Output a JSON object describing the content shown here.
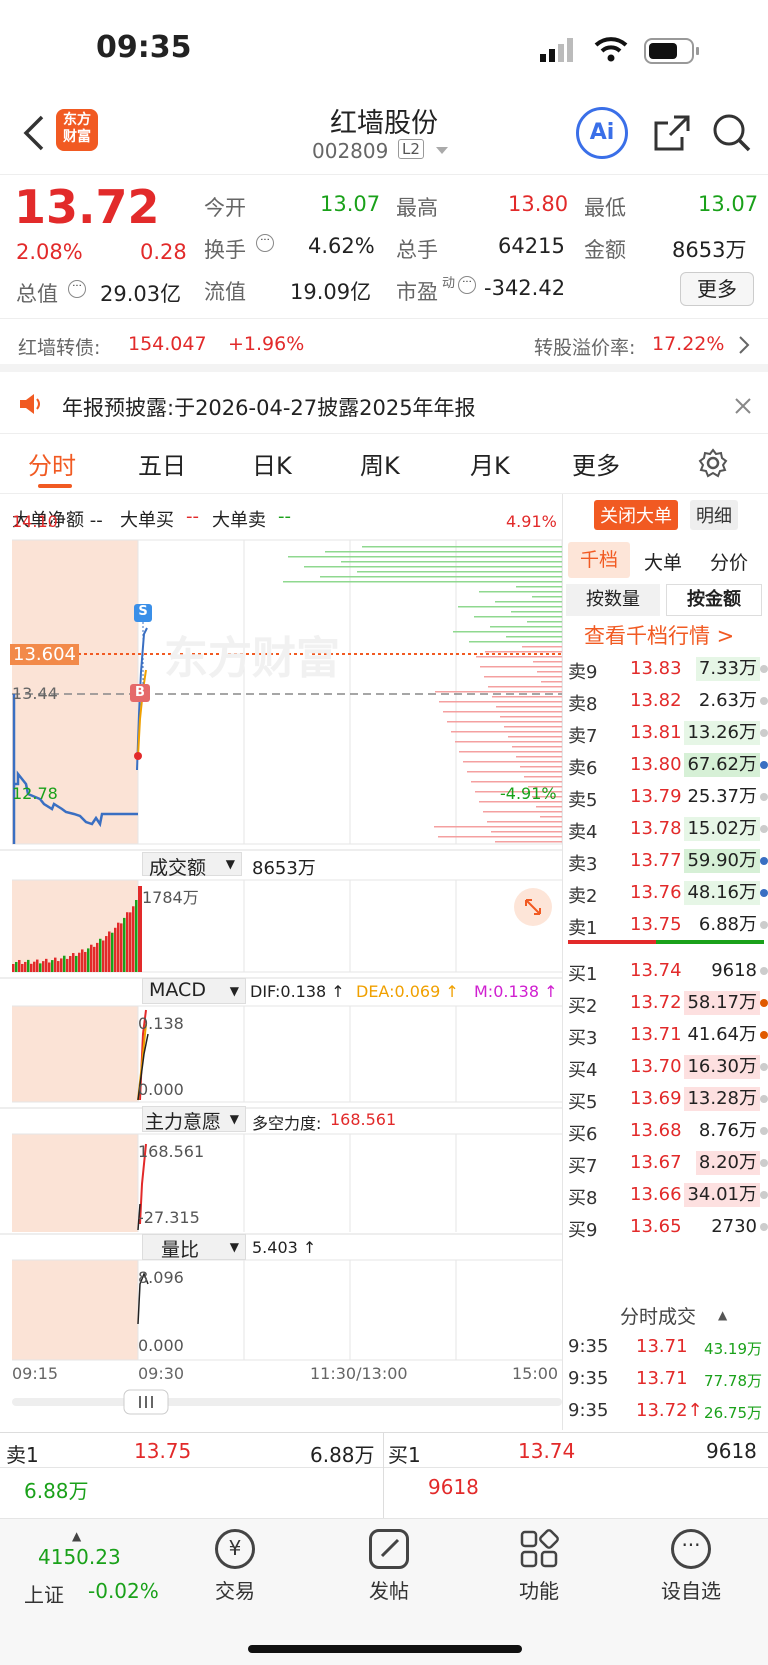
{
  "status": {
    "time": "09:35"
  },
  "header": {
    "title": "红墙股份",
    "code": "002809",
    "level": "L2",
    "logo": "东方\n财富",
    "ai": "Ai"
  },
  "quote": {
    "price": "13.72",
    "pct": "2.08%",
    "chg": "0.28",
    "open_l": "今开",
    "open": "13.07",
    "high_l": "最高",
    "high": "13.80",
    "low_l": "最低",
    "low": "13.07",
    "turn_l": "换手",
    "turn": "4.62%",
    "vol_l": "总手",
    "vol": "64215",
    "amt_l": "金额",
    "amt": "8653万",
    "cap_l": "总值",
    "cap": "29.03亿",
    "float_l": "流值",
    "float": "19.09亿",
    "pe_l": "市盈",
    "pe_sup": "动",
    "pe": "-342.42",
    "more": "更多"
  },
  "bond": {
    "label": "红墙转债:",
    "price": "154.047",
    "pct": "+1.96%",
    "prem_l": "转股溢价率:",
    "prem": "17.22%"
  },
  "notice": {
    "text": "年报预披露:于2026-04-27披露2025年年报"
  },
  "tabs": [
    "分时",
    "五日",
    "日K",
    "周K",
    "月K",
    "更多"
  ],
  "legend": {
    "net": "大单净额 --",
    "buy": "大单买",
    "buy_d": "--",
    "sell": "大单卖",
    "sell_d": "--",
    "close": "关闭大单",
    "detail": "明细"
  },
  "chart": {
    "ymax": "14.10",
    "ymin": "12.78",
    "pmax": "4.91%",
    "pmin": "-4.91%",
    "ref": "13.44",
    "cur": "13.604",
    "watermark": "东方财富",
    "vol_title": "成交额",
    "vol_total": "8653万",
    "vol_max": "1784万",
    "macd_title": "MACD",
    "dif": "DIF:0.138 ↑",
    "dea": "DEA:0.069 ↑",
    "m": "M:0.138 ↑",
    "macd_hi": "0.138",
    "macd_lo": "0.000",
    "main_title": "主力意愿",
    "dk_l": "多空力度:",
    "dk": "168.561",
    "main_hi": "168.561",
    "main_lo": "-27.315",
    "lb_title": "量比",
    "lb_val": "5.403 ↑",
    "lb_hi": "8.096",
    "lb_lo": "0.000",
    "t0": "09:15",
    "t1": "09:30",
    "t2": "11:30/13:00",
    "t3": "15:00",
    "marker_s": "S",
    "marker_b": "B"
  },
  "orderbook": {
    "tab1": "千档",
    "tab2": "大单",
    "tab3": "分价",
    "mode1": "按数量",
    "mode2": "按金额",
    "link": "查看千档行情 >",
    "asks": [
      {
        "l": "卖9",
        "p": "13.83",
        "v": "7.33万"
      },
      {
        "l": "卖8",
        "p": "13.82",
        "v": "2.63万"
      },
      {
        "l": "卖7",
        "p": "13.81",
        "v": "13.26万"
      },
      {
        "l": "卖6",
        "p": "13.80",
        "v": "67.62万"
      },
      {
        "l": "卖5",
        "p": "13.79",
        "v": "25.37万"
      },
      {
        "l": "卖4",
        "p": "13.78",
        "v": "15.02万"
      },
      {
        "l": "卖3",
        "p": "13.77",
        "v": "59.90万"
      },
      {
        "l": "卖2",
        "p": "13.76",
        "v": "48.16万"
      },
      {
        "l": "卖1",
        "p": "13.75",
        "v": "6.88万"
      }
    ],
    "bids": [
      {
        "l": "买1",
        "p": "13.74",
        "v": "9618"
      },
      {
        "l": "买2",
        "p": "13.72",
        "v": "58.17万"
      },
      {
        "l": "买3",
        "p": "13.71",
        "v": "41.64万"
      },
      {
        "l": "买4",
        "p": "13.70",
        "v": "16.30万"
      },
      {
        "l": "买5",
        "p": "13.69",
        "v": "13.28万"
      },
      {
        "l": "买6",
        "p": "13.68",
        "v": "8.76万"
      },
      {
        "l": "买7",
        "p": "13.67",
        "v": "8.20万"
      },
      {
        "l": "买8",
        "p": "13.66",
        "v": "34.01万"
      },
      {
        "l": "买9",
        "p": "13.65",
        "v": "2730"
      }
    ],
    "trade_title": "分时成交",
    "trades": [
      {
        "t": "9:35",
        "p": "13.71",
        "v": "43.19万"
      },
      {
        "t": "9:35",
        "p": "13.71",
        "v": "77.78万"
      },
      {
        "t": "9:35",
        "p": "13.72↑",
        "v": "26.75万"
      }
    ]
  },
  "bottom": {
    "s1_l": "卖1",
    "s1_p": "13.75",
    "s1_v": "6.88万",
    "s1_q": "6.88万",
    "b1_l": "买1",
    "b1_p": "13.74",
    "b1_v": "9618",
    "b1_q": "9618"
  },
  "nav": {
    "idx": "4150.23",
    "idx_name": "上证",
    "idx_pct": "-0.02%",
    "trade": "交易",
    "post": "发帖",
    "func": "功能",
    "fav": "设自选"
  }
}
